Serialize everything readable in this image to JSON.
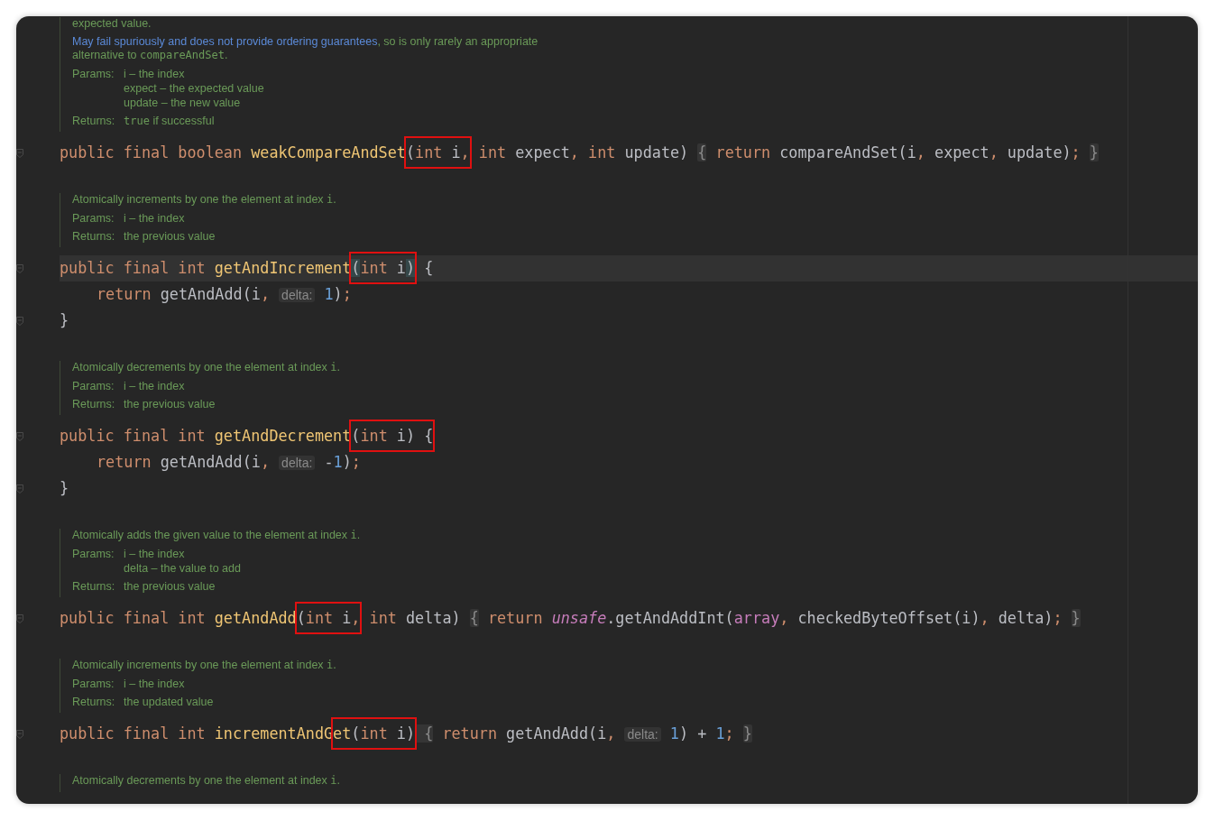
{
  "sections": [
    {
      "doc": {
        "paragraphs": [
          [
            {
              "kind": "text",
              "text": "expected value."
            }
          ],
          [
            {
              "kind": "link",
              "text": "May fail spuriously and does not provide ordering guarantees"
            },
            {
              "kind": "text",
              "text": ", so is only rarely an appropriate alternative to "
            },
            {
              "kind": "code",
              "text": "compareAndSet"
            },
            {
              "kind": "text",
              "text": "."
            }
          ]
        ],
        "tags": [
          {
            "label": "Params:",
            "values": [
              [
                {
                  "kind": "text",
                  "text": "i – the index"
                }
              ],
              [
                {
                  "kind": "text",
                  "text": "expect – the expected value"
                }
              ],
              [
                {
                  "kind": "text",
                  "text": "update – the new value"
                }
              ]
            ]
          },
          {
            "label": "Returns:",
            "values": [
              [
                {
                  "kind": "code",
                  "text": "true"
                },
                {
                  "kind": "text",
                  "text": " if successful"
                }
              ]
            ]
          }
        ]
      },
      "code": [
        {
          "fold": true,
          "current": false,
          "indented": false,
          "parts": [
            {
              "kind": "plain",
              "tokens": [
                {
                  "kind": "kw",
                  "text": "public final boolean "
                },
                {
                  "kind": "fn",
                  "text": "weakCompareAndSet"
                }
              ]
            },
            {
              "kind": "boxed",
              "tokens": [
                {
                  "kind": "plain",
                  "text": "("
                },
                {
                  "kind": "kw",
                  "text": "int"
                },
                {
                  "kind": "plain",
                  "text": " i"
                },
                {
                  "kind": "kw",
                  "text": ","
                }
              ]
            },
            {
              "kind": "plain",
              "tokens": [
                {
                  "kind": "kw",
                  "text": " int"
                },
                {
                  "kind": "plain",
                  "text": " expect"
                },
                {
                  "kind": "kw",
                  "text": ", int"
                },
                {
                  "kind": "plain",
                  "text": " update) "
                },
                {
                  "kind": "fold",
                  "text": "{"
                },
                {
                  "kind": "kw",
                  "text": " return"
                },
                {
                  "kind": "plain",
                  "text": " compareAndSet(i"
                },
                {
                  "kind": "kw",
                  "text": ","
                },
                {
                  "kind": "plain",
                  "text": " expect"
                },
                {
                  "kind": "kw",
                  "text": ","
                },
                {
                  "kind": "plain",
                  "text": " update)"
                },
                {
                  "kind": "kw",
                  "text": "; "
                },
                {
                  "kind": "fold",
                  "text": "}"
                }
              ]
            }
          ]
        }
      ]
    },
    {
      "doc": {
        "paragraphs": [
          [
            {
              "kind": "text",
              "text": "Atomically increments by one the element at index "
            },
            {
              "kind": "code",
              "text": "i"
            },
            {
              "kind": "text",
              "text": "."
            }
          ]
        ],
        "tags": [
          {
            "label": "Params:",
            "values": [
              [
                {
                  "kind": "text",
                  "text": "i – the index"
                }
              ]
            ]
          },
          {
            "label": "Returns:",
            "values": [
              [
                {
                  "kind": "text",
                  "text": "the previous value"
                }
              ]
            ]
          }
        ]
      },
      "code": [
        {
          "fold": true,
          "current": true,
          "indented": false,
          "parts": [
            {
              "kind": "plain",
              "tokens": [
                {
                  "kind": "kw",
                  "text": "public final int "
                },
                {
                  "kind": "fn",
                  "text": "getAndIncrement"
                }
              ]
            },
            {
              "kind": "boxed",
              "tokens": [
                {
                  "kind": "match",
                  "text": "("
                },
                {
                  "kind": "kw",
                  "text": "int"
                },
                {
                  "kind": "plain",
                  "text": " i"
                },
                {
                  "kind": "match",
                  "text": ")"
                }
              ]
            },
            {
              "kind": "plain",
              "tokens": [
                {
                  "kind": "plain",
                  "text": " {"
                }
              ]
            }
          ]
        },
        {
          "fold": false,
          "current": false,
          "indented": true,
          "parts": [
            {
              "kind": "plain",
              "tokens": [
                {
                  "kind": "kw",
                  "text": "return"
                },
                {
                  "kind": "plain",
                  "text": " getAndAdd(i"
                },
                {
                  "kind": "kw",
                  "text": ", "
                },
                {
                  "kind": "hint",
                  "text": "delta:"
                },
                {
                  "kind": "num",
                  "text": " 1"
                },
                {
                  "kind": "plain",
                  "text": ")"
                },
                {
                  "kind": "kw",
                  "text": ";"
                }
              ]
            }
          ]
        },
        {
          "fold": true,
          "current": false,
          "indented": false,
          "parts": [
            {
              "kind": "plain",
              "tokens": [
                {
                  "kind": "plain",
                  "text": "}"
                }
              ]
            }
          ]
        }
      ]
    },
    {
      "doc": {
        "paragraphs": [
          [
            {
              "kind": "text",
              "text": "Atomically decrements by one the element at index "
            },
            {
              "kind": "code",
              "text": "i"
            },
            {
              "kind": "text",
              "text": "."
            }
          ]
        ],
        "tags": [
          {
            "label": "Params:",
            "values": [
              [
                {
                  "kind": "text",
                  "text": "i – the index"
                }
              ]
            ]
          },
          {
            "label": "Returns:",
            "values": [
              [
                {
                  "kind": "text",
                  "text": "the previous value"
                }
              ]
            ]
          }
        ]
      },
      "code": [
        {
          "fold": true,
          "current": false,
          "indented": false,
          "parts": [
            {
              "kind": "plain",
              "tokens": [
                {
                  "kind": "kw",
                  "text": "public final int "
                },
                {
                  "kind": "fn",
                  "text": "getAndDecrement"
                }
              ]
            },
            {
              "kind": "boxed",
              "tokens": [
                {
                  "kind": "plain",
                  "text": "("
                },
                {
                  "kind": "kw",
                  "text": "int"
                },
                {
                  "kind": "plain",
                  "text": " i) {"
                }
              ]
            }
          ]
        },
        {
          "fold": false,
          "current": false,
          "indented": true,
          "parts": [
            {
              "kind": "plain",
              "tokens": [
                {
                  "kind": "kw",
                  "text": "return"
                },
                {
                  "kind": "plain",
                  "text": " getAndAdd(i"
                },
                {
                  "kind": "kw",
                  "text": ", "
                },
                {
                  "kind": "hint",
                  "text": "delta:"
                },
                {
                  "kind": "plain",
                  "text": " -"
                },
                {
                  "kind": "num",
                  "text": "1"
                },
                {
                  "kind": "plain",
                  "text": ")"
                },
                {
                  "kind": "kw",
                  "text": ";"
                }
              ]
            }
          ]
        },
        {
          "fold": true,
          "current": false,
          "indented": false,
          "parts": [
            {
              "kind": "plain",
              "tokens": [
                {
                  "kind": "plain",
                  "text": "}"
                }
              ]
            }
          ]
        }
      ]
    },
    {
      "doc": {
        "paragraphs": [
          [
            {
              "kind": "text",
              "text": "Atomically adds the given value to the element at index "
            },
            {
              "kind": "code",
              "text": "i"
            },
            {
              "kind": "text",
              "text": "."
            }
          ]
        ],
        "tags": [
          {
            "label": "Params:",
            "values": [
              [
                {
                  "kind": "text",
                  "text": "i – the index"
                }
              ],
              [
                {
                  "kind": "text",
                  "text": "delta – the value to add"
                }
              ]
            ]
          },
          {
            "label": "Returns:",
            "values": [
              [
                {
                  "kind": "text",
                  "text": "the previous value"
                }
              ]
            ]
          }
        ]
      },
      "code": [
        {
          "fold": true,
          "current": false,
          "indented": false,
          "parts": [
            {
              "kind": "plain",
              "tokens": [
                {
                  "kind": "kw",
                  "text": "public final int "
                },
                {
                  "kind": "fn",
                  "text": "getAndAdd"
                }
              ]
            },
            {
              "kind": "boxed",
              "tokens": [
                {
                  "kind": "plain",
                  "text": "("
                },
                {
                  "kind": "kw",
                  "text": "int"
                },
                {
                  "kind": "plain",
                  "text": " i"
                },
                {
                  "kind": "kw",
                  "text": ","
                }
              ]
            },
            {
              "kind": "plain",
              "tokens": [
                {
                  "kind": "kw",
                  "text": " int"
                },
                {
                  "kind": "plain",
                  "text": " delta) "
                },
                {
                  "kind": "fold",
                  "text": "{"
                },
                {
                  "kind": "kw",
                  "text": " return "
                },
                {
                  "kind": "static",
                  "text": "unsafe"
                },
                {
                  "kind": "plain",
                  "text": ".getAndAddInt("
                },
                {
                  "kind": "field",
                  "text": "array"
                },
                {
                  "kind": "kw",
                  "text": ","
                },
                {
                  "kind": "plain",
                  "text": " checkedByteOffset(i)"
                },
                {
                  "kind": "kw",
                  "text": ","
                },
                {
                  "kind": "plain",
                  "text": " delta)"
                },
                {
                  "kind": "kw",
                  "text": "; "
                },
                {
                  "kind": "fold",
                  "text": "}"
                }
              ]
            }
          ]
        }
      ]
    },
    {
      "doc": {
        "paragraphs": [
          [
            {
              "kind": "text",
              "text": "Atomically increments by one the element at index "
            },
            {
              "kind": "code",
              "text": "i"
            },
            {
              "kind": "text",
              "text": "."
            }
          ]
        ],
        "tags": [
          {
            "label": "Params:",
            "values": [
              [
                {
                  "kind": "text",
                  "text": "i – the index"
                }
              ]
            ]
          },
          {
            "label": "Returns:",
            "values": [
              [
                {
                  "kind": "text",
                  "text": "the updated value"
                }
              ]
            ]
          }
        ]
      },
      "code": [
        {
          "fold": true,
          "current": false,
          "indented": false,
          "parts": [
            {
              "kind": "plain",
              "tokens": [
                {
                  "kind": "kw",
                  "text": "public final int "
                },
                {
                  "kind": "fn",
                  "text": "incrementAndG"
                }
              ]
            },
            {
              "kind": "boxed",
              "tokens": [
                {
                  "kind": "fn",
                  "text": "et"
                },
                {
                  "kind": "plain",
                  "text": "("
                },
                {
                  "kind": "kw",
                  "text": "int"
                },
                {
                  "kind": "plain",
                  "text": " i)"
                }
              ]
            },
            {
              "kind": "plain",
              "tokens": [
                {
                  "kind": "fold",
                  "text": " {"
                },
                {
                  "kind": "kw",
                  "text": " return"
                },
                {
                  "kind": "plain",
                  "text": " getAndAdd(i"
                },
                {
                  "kind": "kw",
                  "text": ", "
                },
                {
                  "kind": "hint",
                  "text": "delta:"
                },
                {
                  "kind": "num",
                  "text": " 1"
                },
                {
                  "kind": "plain",
                  "text": ") + "
                },
                {
                  "kind": "num",
                  "text": "1"
                },
                {
                  "kind": "kw",
                  "text": "; "
                },
                {
                  "kind": "fold",
                  "text": "}"
                }
              ]
            }
          ]
        }
      ]
    },
    {
      "doc": {
        "paragraphs": [
          [
            {
              "kind": "text",
              "text": "Atomically decrements by one the element at index "
            },
            {
              "kind": "code",
              "text": "i"
            },
            {
              "kind": "text",
              "text": "."
            }
          ]
        ]
      }
    }
  ]
}
